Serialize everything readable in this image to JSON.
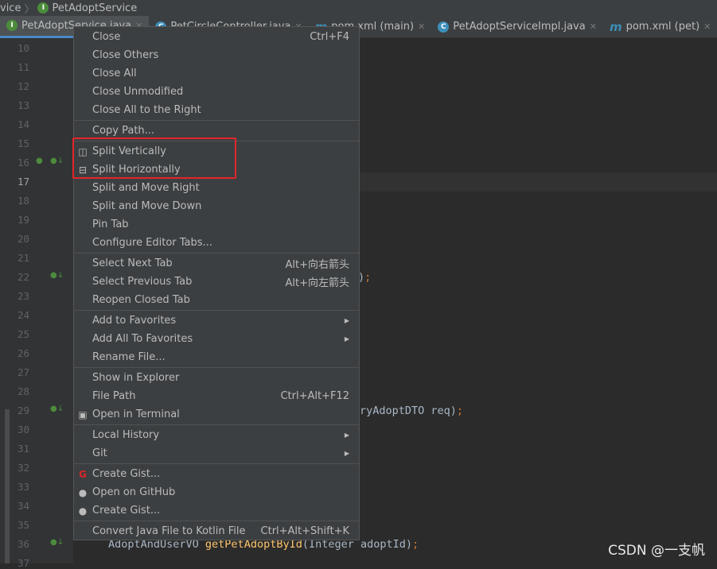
{
  "breadcrumb": {
    "parent": "vice",
    "current": "PetAdoptService"
  },
  "tabs": [
    {
      "label": "PetAdoptService.java",
      "icon": "interface-icon",
      "active": true
    },
    {
      "label": "PetCircleController.java",
      "icon": "class-icon"
    },
    {
      "label": "pom.xml (main)",
      "icon": "maven-icon"
    },
    {
      "label": "PetAdoptServiceImpl.java",
      "icon": "class-icon"
    },
    {
      "label": "pom.xml (pet)",
      "icon": "maven-icon"
    }
  ],
  "line_numbers": [
    "10",
    "11",
    "12",
    "13",
    "14",
    "15",
    "16",
    "17",
    "18",
    "19",
    "20",
    "21",
    "22",
    "23",
    "24",
    "25",
    "26",
    "27",
    "28",
    "29",
    "30",
    "31",
    "32",
    "33",
    "34",
    "35",
    "36",
    "37"
  ],
  "code": {
    "line22_tail": ")",
    "line22_semi": ";",
    "line29_tail": "ryAdoptDTO req)",
    "line29_semi": ";",
    "line36_type": "AdoptAndUserVO ",
    "line36_fn": "getPetAdoptById",
    "line36_args": "(Integer adoptId)",
    "line36_semi": ";"
  },
  "menu": {
    "sections": [
      [
        {
          "label": "Close",
          "shortcut": "Ctrl+F4"
        },
        {
          "label": "Close Others"
        },
        {
          "label": "Close All"
        },
        {
          "label": "Close Unmodified"
        },
        {
          "label": "Close All to the Right"
        }
      ],
      [
        {
          "label": "Copy Path..."
        }
      ],
      [
        {
          "label": "Split Vertically",
          "icon": "split-vertical-icon",
          "glyph": "◫"
        },
        {
          "label": "Split Horizontally",
          "icon": "split-horizontal-icon",
          "glyph": "⊟"
        },
        {
          "label": "Split and Move Right"
        },
        {
          "label": "Split and Move Down"
        },
        {
          "label": "Pin Tab"
        },
        {
          "label": "Configure Editor Tabs..."
        }
      ],
      [
        {
          "label": "Select Next Tab",
          "shortcut": "Alt+向右箭头"
        },
        {
          "label": "Select Previous Tab",
          "shortcut": "Alt+向左箭头"
        },
        {
          "label": "Reopen Closed Tab"
        }
      ],
      [
        {
          "label": "Add to Favorites",
          "submenu": true
        },
        {
          "label": "Add All To Favorites",
          "submenu": true
        },
        {
          "label": "Rename File..."
        }
      ],
      [
        {
          "label": "Show in Explorer"
        },
        {
          "label": "File Path",
          "shortcut": "Ctrl+Alt+F12"
        },
        {
          "label": "Open in Terminal",
          "icon": "terminal-icon",
          "glyph": "▣"
        }
      ],
      [
        {
          "label": "Local History",
          "submenu": true
        },
        {
          "label": "Git",
          "submenu": true
        }
      ],
      [
        {
          "label": "Create Gist...",
          "icon": "gitee-icon",
          "glyph": "G"
        },
        {
          "label": "Open on GitHub",
          "icon": "github-icon",
          "glyph": "●"
        },
        {
          "label": "Create Gist...",
          "icon": "github-icon",
          "glyph": "●"
        }
      ],
      [
        {
          "label": "Convert Java File to Kotlin File",
          "shortcut": "Ctrl+Alt+Shift+K"
        }
      ]
    ]
  },
  "watermark": "CSDN @一支帆",
  "colors": {
    "highlight_box": "#e3262a",
    "menu_bg": "#3c3f41",
    "editor_bg": "#2b2b2b"
  }
}
